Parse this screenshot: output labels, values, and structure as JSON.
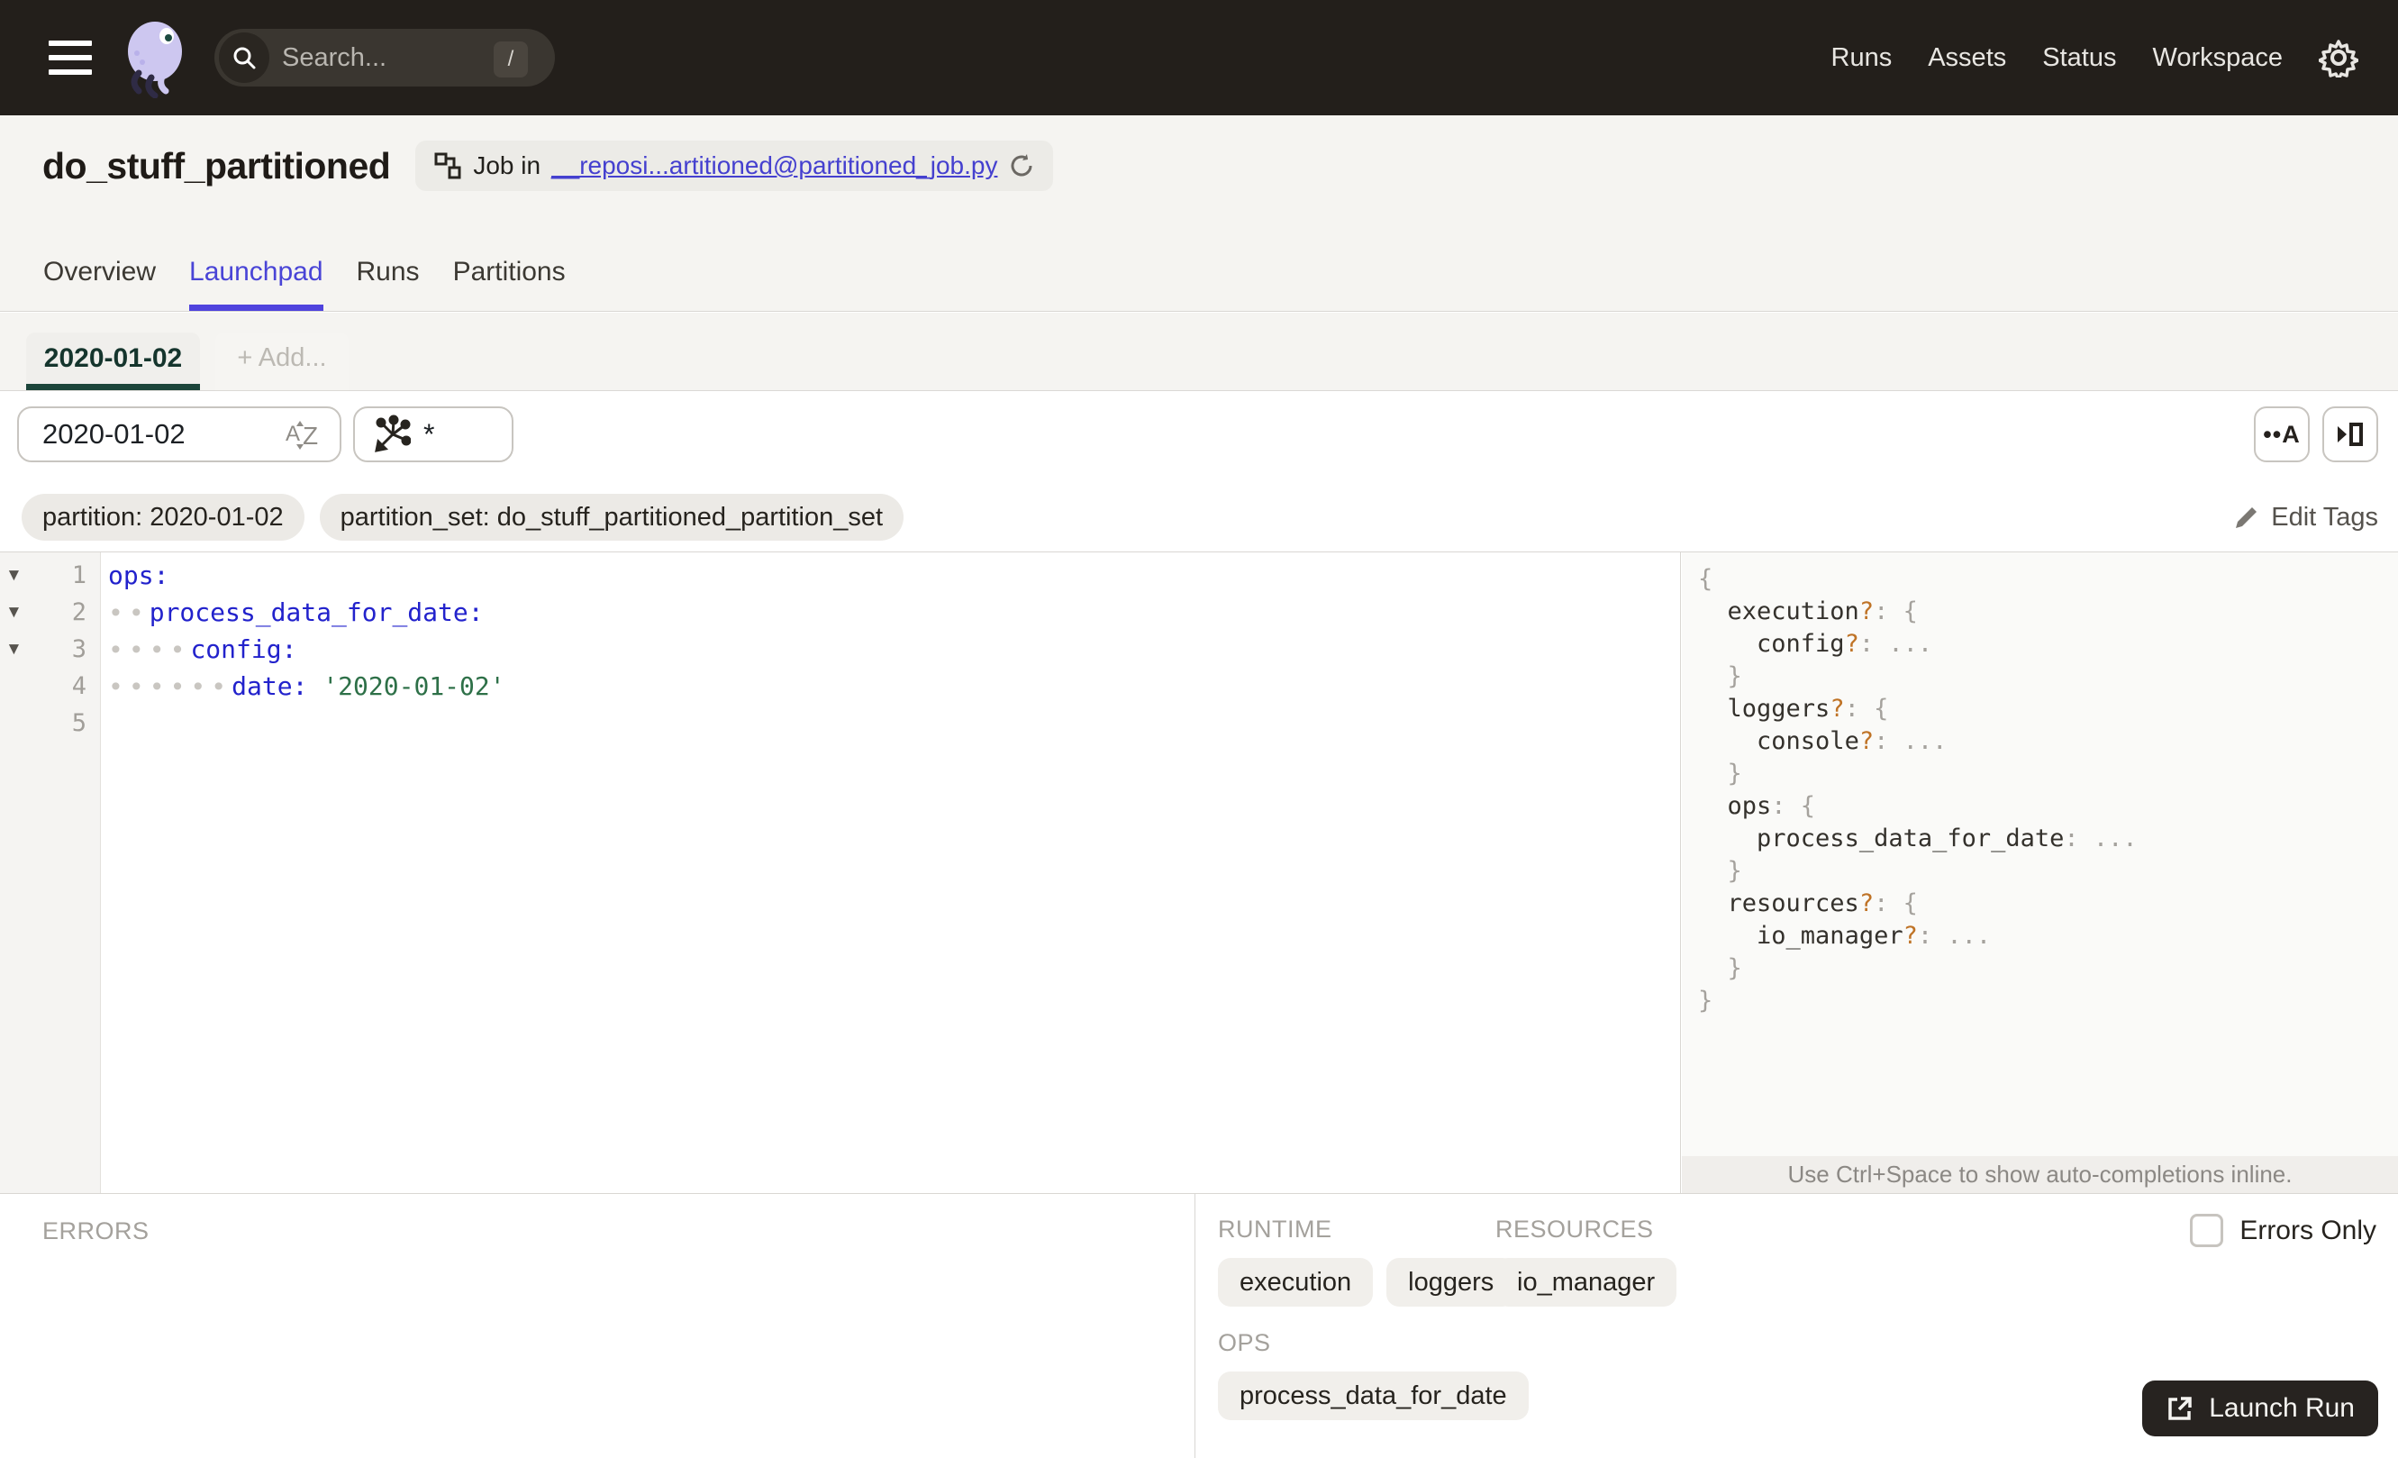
{
  "topbar": {
    "search": {
      "placeholder": "Search...",
      "shortcut": "/"
    },
    "nav_items": [
      {
        "label": "Runs"
      },
      {
        "label": "Assets"
      },
      {
        "label": "Status"
      },
      {
        "label": "Workspace"
      }
    ]
  },
  "header": {
    "title": "do_stuff_partitioned",
    "job_badge": {
      "prefix": "Job in",
      "link_text": "__reposi...artitioned@partitioned_job.py"
    },
    "tabs": [
      {
        "label": "Overview"
      },
      {
        "label": "Launchpad"
      },
      {
        "label": "Runs"
      },
      {
        "label": "Partitions"
      }
    ]
  },
  "launchpad": {
    "config_tab_label": "2020-01-02",
    "add_tab_label": "+ Add...",
    "partition_select_value": "2020-01-02",
    "op_selection_value": "*",
    "tags": [
      {
        "label": "partition: 2020-01-02"
      },
      {
        "label": "partition_set: do_stuff_partitioned_partition_set"
      }
    ],
    "edit_tags_label": "Edit Tags",
    "editor": {
      "line_numbers": [
        "1",
        "2",
        "3",
        "4",
        "5"
      ],
      "lines": [
        {
          "t0": "ops:"
        },
        {
          "ws": "∙∙",
          "t0": "process_data_for_date:"
        },
        {
          "ws": "∙∙∙∙",
          "t0": "config:"
        },
        {
          "ws": "∙∙∙∙∙∙",
          "t0": "date:",
          "sep": " ",
          "str": "'2020-01-02'"
        }
      ]
    },
    "schema": {
      "lines": [
        {
          "p0": "{"
        },
        {
          "ind": "  ",
          "k": "execution",
          "q": "?",
          "p1": ": {"
        },
        {
          "ind": "    ",
          "k": "config",
          "q": "?",
          "p1": ": ..."
        },
        {
          "ind": "  ",
          "p0": "}"
        },
        {
          "ind": "  ",
          "k": "loggers",
          "q": "?",
          "p1": ": {"
        },
        {
          "ind": "    ",
          "k": "console",
          "q": "?",
          "p1": ": ..."
        },
        {
          "ind": "  ",
          "p0": "}"
        },
        {
          "ind": "  ",
          "k": "ops",
          "p1": ": {"
        },
        {
          "ind": "    ",
          "k": "process_data_for_date",
          "p1": ": ..."
        },
        {
          "ind": "  ",
          "p0": "}"
        },
        {
          "ind": "  ",
          "k": "resources",
          "q": "?",
          "p1": ": {"
        },
        {
          "ind": "    ",
          "k": "io_manager",
          "q": "?",
          "p1": ": ..."
        },
        {
          "ind": "  ",
          "p0": "}"
        },
        {
          "p0": "}"
        }
      ],
      "hint": "Use Ctrl+Space to show auto-completions inline."
    },
    "bottom": {
      "errors_title": "ERRORS",
      "errors_only_label": "Errors Only",
      "runtime_title": "RUNTIME",
      "runtime_chips": [
        {
          "label": "execution"
        },
        {
          "label": "loggers"
        }
      ],
      "resources_title": "RESOURCES",
      "resources_chips": [
        {
          "label": "io_manager"
        }
      ],
      "ops_title": "OPS",
      "ops_chips": [
        {
          "label": "process_data_for_date"
        }
      ],
      "launch_label": "Launch Run"
    }
  },
  "colors": {
    "topbar_bg": "#231f1b",
    "accent_indigo": "#4f43dd",
    "partition_green": "#1c453a",
    "code_key_blue": "#2222cc",
    "code_string_green": "#2e7048",
    "schema_optional_orange": "#bf7326"
  }
}
